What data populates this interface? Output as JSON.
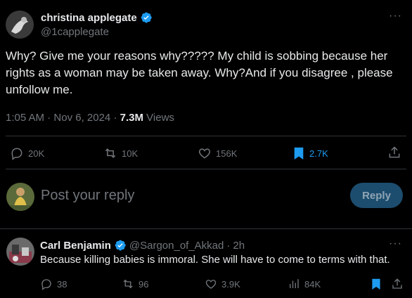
{
  "post": {
    "author": {
      "display_name": "christina applegate",
      "handle": "@1capplegate",
      "verified": true
    },
    "more_label": "···",
    "text": "Why? Give me your reasons why????? My child is sobbing because her rights as a woman may be taken away. Why?And if you disagree , please unfollow me.",
    "time": "1:05 AM",
    "separator": "·",
    "date": "Nov 6, 2024",
    "views_count": "7.3M",
    "views_label": "Views",
    "actions": {
      "replies": "20K",
      "reposts": "10K",
      "likes": "156K",
      "bookmarks": "2.7K"
    }
  },
  "reply_composer": {
    "placeholder": "Post your reply",
    "button_label": "Reply"
  },
  "comment": {
    "display_name": "Carl Benjamin",
    "handle": "@Sargon_of_Akkad",
    "separator": "·",
    "time_ago": "2h",
    "text": "Because killing babies is immoral. She will have to come to terms with that.",
    "more_label": "···",
    "actions": {
      "replies": "38",
      "reposts": "96",
      "likes": "3.9K",
      "views": "84K"
    }
  },
  "colors": {
    "background": "#000000",
    "text": "#e7e9ea",
    "muted": "#71767b",
    "accent": "#1d9bf0",
    "divider": "#2f3336"
  }
}
